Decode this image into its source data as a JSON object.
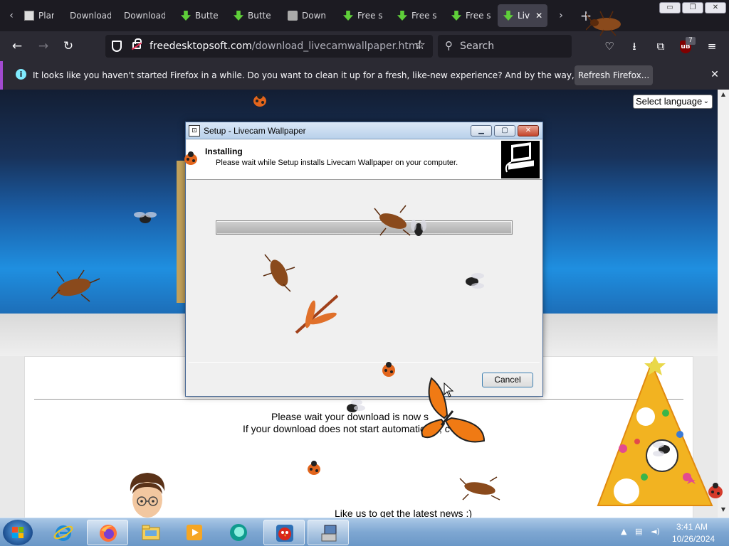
{
  "browser": {
    "tabs": [
      {
        "label": "Plant",
        "icon": "doc-icon",
        "active": false
      },
      {
        "label": "Download",
        "icon": "none",
        "active": false
      },
      {
        "label": "Download",
        "icon": "none",
        "active": false
      },
      {
        "label": "Butte",
        "icon": "download-arrow-icon",
        "active": false
      },
      {
        "label": "Butte",
        "icon": "download-arrow-icon",
        "active": false
      },
      {
        "label": "Down",
        "icon": "page-icon",
        "active": false
      },
      {
        "label": "Free s",
        "icon": "download-arrow-icon",
        "active": false
      },
      {
        "label": "Free s",
        "icon": "download-arrow-icon",
        "active": false
      },
      {
        "label": "Free s",
        "icon": "download-arrow-icon",
        "active": false
      },
      {
        "label": "Liv",
        "icon": "download-arrow-icon",
        "active": true
      }
    ],
    "url_domain": "freedesktopsoft.com",
    "url_path": "/download_livecamwallpaper.html",
    "search_placeholder": "Search",
    "extension_badge": "7",
    "accent": "#a24ad0"
  },
  "notification": {
    "message": "It looks like you haven't started Firefox in a while. Do you want to clean it up for a fresh, like-new experience? And by the way, welcome back!",
    "button": "Refresh Firefox..."
  },
  "page": {
    "select_language": "Select language",
    "wait_line1": "Please wait your download is now s",
    "wait_line2": "If your download does not start automatically, c",
    "like_us": "Like us to get the latest news :)"
  },
  "dialog": {
    "title": "Setup - Livecam Wallpaper",
    "heading": "Installing",
    "subheading": "Please wait while Setup installs Livecam Wallpaper on your computer.",
    "progress": 1.0,
    "cancel": "Cancel"
  },
  "taskbar": {
    "time": "3:41 AM",
    "date": "10/26/2024"
  }
}
